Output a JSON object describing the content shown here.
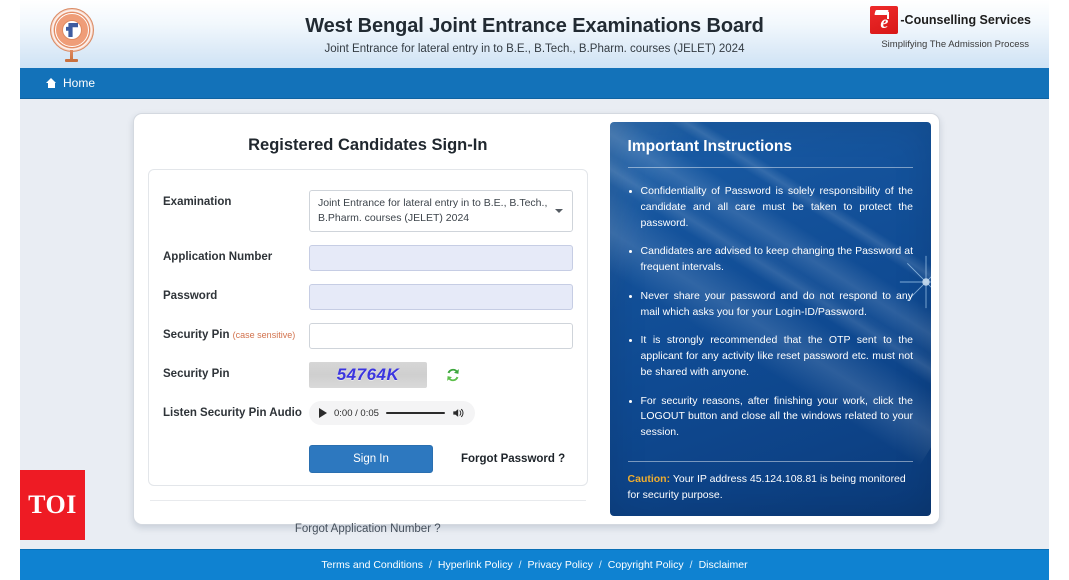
{
  "header": {
    "title": "West Bengal Joint Entrance Examinations Board",
    "subtitle": "Joint Entrance for lateral entry in to B.E., B.Tech., B.Pharm. courses (JELET) 2024",
    "left_logo_alt": "wbjeeb-seal",
    "brand": {
      "mark_letter": "e",
      "name": "-Counselling Services",
      "tagline": "Simplifying The Admission Process"
    }
  },
  "navbar": {
    "home_label": "Home"
  },
  "login": {
    "title": "Registered Candidates Sign-In",
    "fields": {
      "examination_label": "Examination",
      "examination_value": "Joint Entrance for lateral entry in to B.E., B.Tech., B.Pharm. courses (JELET) 2024",
      "application_number_label": "Application Number",
      "application_number_value": "",
      "application_number_placeholder": "",
      "password_label": "Password",
      "password_value": "",
      "password_placeholder": "",
      "security_pin_input_label": "Security Pin",
      "security_pin_input_hint": "(case sensitive)",
      "security_pin_value": "",
      "security_pin_placeholder": "",
      "security_pin_image_label": "Security Pin",
      "captcha_text": "54764K",
      "refresh_icon": "refresh-captcha-icon",
      "audio_label": "Listen Security Pin Audio",
      "audio_time": "0:00 / 0:05"
    },
    "buttons": {
      "sign_in": "Sign In",
      "forgot_password": "Forgot Password ?",
      "forgot_application_number": "Forgot Application Number ?"
    }
  },
  "instructions": {
    "title": "Important Instructions",
    "items": [
      "Confidentiality of Password is solely responsibility of the candidate and all care must be taken to protect the password.",
      "Candidates are advised to keep changing the Password at frequent intervals.",
      "Never share your password and do not respond to any mail which asks you for your Login-ID/Password.",
      "It is strongly recommended that the OTP sent to the applicant for any activity like reset password etc. must not be shared with anyone.",
      "For security reasons, after finishing your work, click the LOGOUT button and close all the windows related to your session."
    ],
    "caution_label": "Caution:",
    "caution_text": " Your IP address 45.124.108.81 is being monitored for security purpose."
  },
  "watermark": {
    "text": "TOI"
  },
  "footer": {
    "links": [
      "Terms and Conditions",
      "Hyperlink Policy",
      "Privacy Policy",
      "Copyright Policy",
      "Disclaimer"
    ],
    "separator": "/"
  },
  "colors": {
    "nav_blue": "#1372b9",
    "footer_blue": "#0f82d1",
    "panel_blue": "#0f4a92",
    "accent_button": "#2d78bf",
    "caution_gold": "#f0ad2e",
    "captcha_text": "#3b35e0",
    "brand_red": "#ee2b2b",
    "watermark_red": "#ee1b24"
  }
}
